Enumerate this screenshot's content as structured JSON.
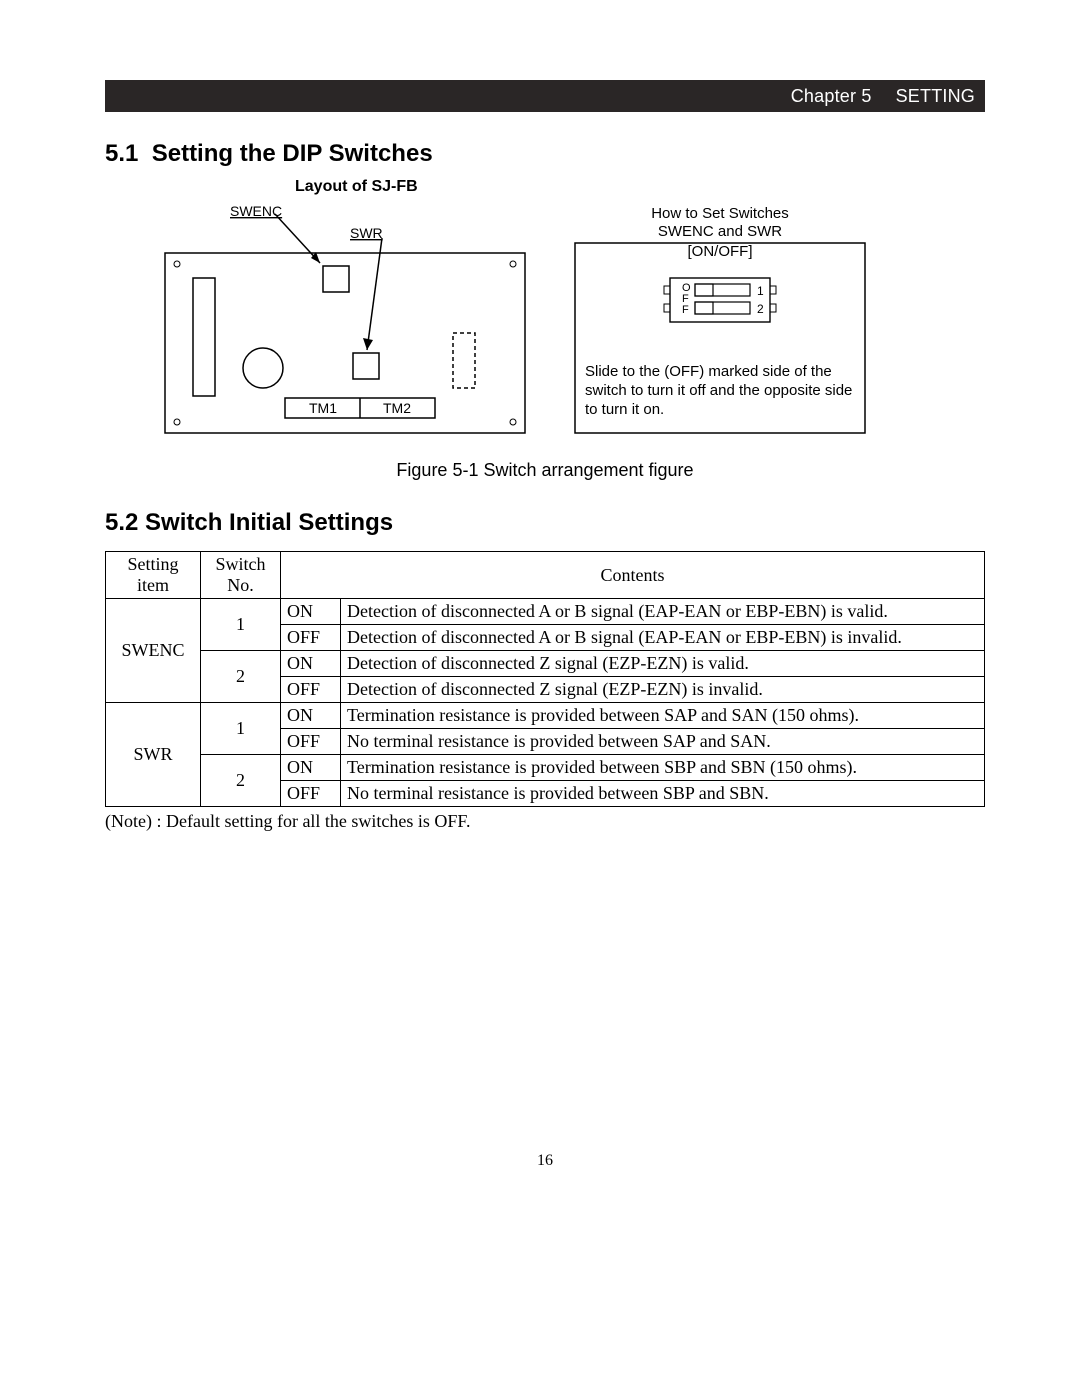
{
  "header": {
    "chapter": "Chapter 5",
    "title": "SETTING"
  },
  "section1": {
    "number": "5.1",
    "title": "Setting the DIP Switches",
    "layout_title": "Layout of SJ-FB",
    "figure_caption": "Figure 5-1  Switch arrangement figure",
    "board": {
      "swenc": "SWENC",
      "swr": "SWR",
      "tm1": "TM1",
      "tm2": "TM2"
    },
    "howto": {
      "l1": "How to Set Switches",
      "l2": "SWENC and SWR",
      "l3": "[ON/OFF]",
      "off_col": "OFF",
      "n1": "1",
      "n2": "2",
      "note": "Slide to the (OFF) marked side of the switch to turn it off and the opposite side to turn it on."
    }
  },
  "section2": {
    "number": "5.2",
    "title": "Switch Initial Settings",
    "table": {
      "h_setting": "Setting item",
      "h_switch": "Switch No.",
      "h_contents": "Contents",
      "swenc": "SWENC",
      "swr": "SWR",
      "n1": "1",
      "n2": "2",
      "on": "ON",
      "off": "OFF",
      "r1_on": "Detection of disconnected A or B signal (EAP-EAN or EBP-EBN) is valid.",
      "r1_off": "Detection of disconnected A or B signal (EAP-EAN or EBP-EBN)  is invalid.",
      "r2_on": "Detection of disconnected Z signal (EZP-EZN) is valid.",
      "r2_off": "Detection of disconnected Z signal (EZP-EZN) is invalid.",
      "r3_on": "Termination resistance is provided between SAP and SAN (150 ohms).",
      "r3_off": "No terminal resistance is provided between SAP and SAN.",
      "r4_on": "Termination resistance is provided between SBP and SBN (150 ohms).",
      "r4_off": "No terminal resistance is provided between SBP and SBN."
    },
    "note": "(Note) :  Default setting for all the switches is OFF."
  },
  "page_number": "16"
}
